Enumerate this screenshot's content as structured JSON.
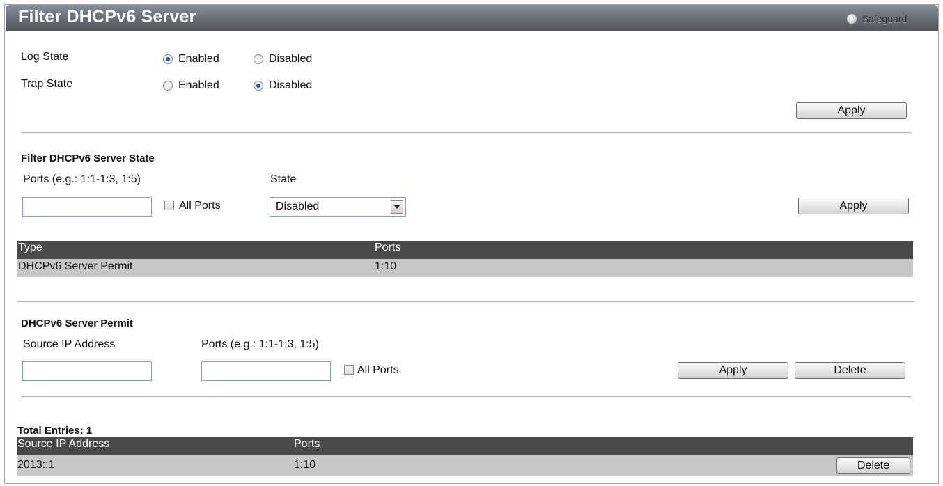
{
  "header": {
    "title": "Filter DHCPv6 Server",
    "safeguard_label": "Safeguard"
  },
  "log_trap": {
    "log_label": "Log State",
    "trap_label": "Trap State",
    "enabled_label": "Enabled",
    "disabled_label": "Disabled",
    "log_value": "Enabled",
    "trap_value": "Disabled",
    "apply_label": "Apply"
  },
  "server_state": {
    "heading": "Filter DHCPv6 Server State",
    "ports_label": "Ports (e.g.: 1:1-1:3, 1:5)",
    "ports_value": "",
    "all_ports_label": "All Ports",
    "state_label": "State",
    "state_value": "Disabled",
    "apply_label": "Apply"
  },
  "state_table": {
    "columns": [
      "Type",
      "Ports"
    ],
    "rows": [
      [
        "DHCPv6 Server Permit",
        "1:10"
      ]
    ]
  },
  "permit": {
    "heading": "DHCPv6 Server Permit",
    "source_ip_label": "Source IP Address",
    "source_ip_value": "",
    "ports_label": "Ports (e.g.: 1:1-1:3, 1:5)",
    "ports_value": "",
    "all_ports_label": "All Ports",
    "apply_label": "Apply",
    "delete_label": "Delete"
  },
  "entries": {
    "total_label": "Total Entries: 1",
    "columns": [
      "Source IP Address",
      "Ports"
    ],
    "rows": [
      {
        "source_ip": "2013::1",
        "ports": "1:10",
        "delete_label": "Delete"
      }
    ]
  },
  "colors": {
    "header_bg": "#4a4a4a",
    "row_bg": "#c7c7c7",
    "radio_selected": "#1f59b9",
    "input_border": "#7da2ce"
  }
}
